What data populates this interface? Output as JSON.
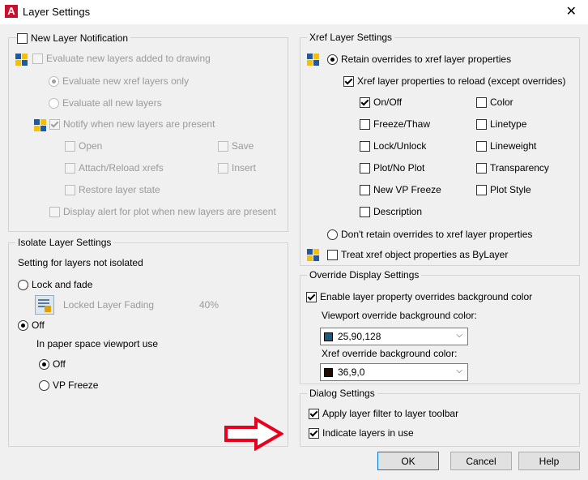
{
  "window": {
    "title": "Layer Settings",
    "app_icon_letter": "A",
    "close_glyph": "✕"
  },
  "new_layer": {
    "checkbox_label": "New Layer Notification",
    "evaluate_label": "Evaluate new layers added to drawing",
    "xref_only_label": "Evaluate new xref layers only",
    "all_new_label": "Evaluate all new layers",
    "notify_label": "Notify when new layers are present",
    "open_label": "Open",
    "save_label": "Save",
    "attach_label": "Attach/Reload xrefs",
    "insert_label": "Insert",
    "restore_label": "Restore layer state",
    "plot_alert_label": "Display alert for plot when new layers are present"
  },
  "isolate": {
    "title": "Isolate Layer Settings",
    "subtitle": "Setting for layers not isolated",
    "lock_fade_label": "Lock and fade",
    "fading_label": "Locked Layer Fading",
    "fading_value": "40%",
    "off_label": "Off",
    "paper_label": "In paper space viewport use",
    "paper_off_label": "Off",
    "vp_freeze_label": "VP Freeze"
  },
  "xref": {
    "title": "Xref Layer Settings",
    "retain_label": "Retain overrides to xref layer properties",
    "reload_label": "Xref layer properties to reload (except overrides)",
    "props_left": [
      {
        "label": "On/Off",
        "checked": true
      },
      {
        "label": "Freeze/Thaw",
        "checked": false
      },
      {
        "label": "Lock/Unlock",
        "checked": false
      },
      {
        "label": "Plot/No Plot",
        "checked": false
      },
      {
        "label": "New VP Freeze",
        "checked": false
      },
      {
        "label": "Description",
        "checked": false
      }
    ],
    "props_right": [
      {
        "label": "Color",
        "checked": false
      },
      {
        "label": "Linetype",
        "checked": false
      },
      {
        "label": "Lineweight",
        "checked": false
      },
      {
        "label": "Transparency",
        "checked": false
      },
      {
        "label": "Plot Style",
        "checked": false
      }
    ],
    "dont_retain_label": "Don't retain overrides to xref layer properties",
    "treat_label": "Treat xref object properties as ByLayer"
  },
  "override": {
    "title": "Override Display Settings",
    "enable_label": "Enable layer property overrides background color",
    "vp_color_label": "Viewport override background color:",
    "vp_color_value": "25,90,128",
    "vp_color_hex": "#195a80",
    "xref_color_label": "Xref override background color:",
    "xref_color_value": "36,9,0",
    "xref_color_hex": "#240900"
  },
  "dialog": {
    "title": "Dialog Settings",
    "apply_filter_label": "Apply layer filter to layer toolbar",
    "indicate_label": "Indicate layers in use"
  },
  "buttons": {
    "ok": "OK",
    "cancel": "Cancel",
    "help": "Help"
  },
  "colors": {
    "arrow_red": "#e8001c",
    "accent_blue": "#0078d7"
  }
}
